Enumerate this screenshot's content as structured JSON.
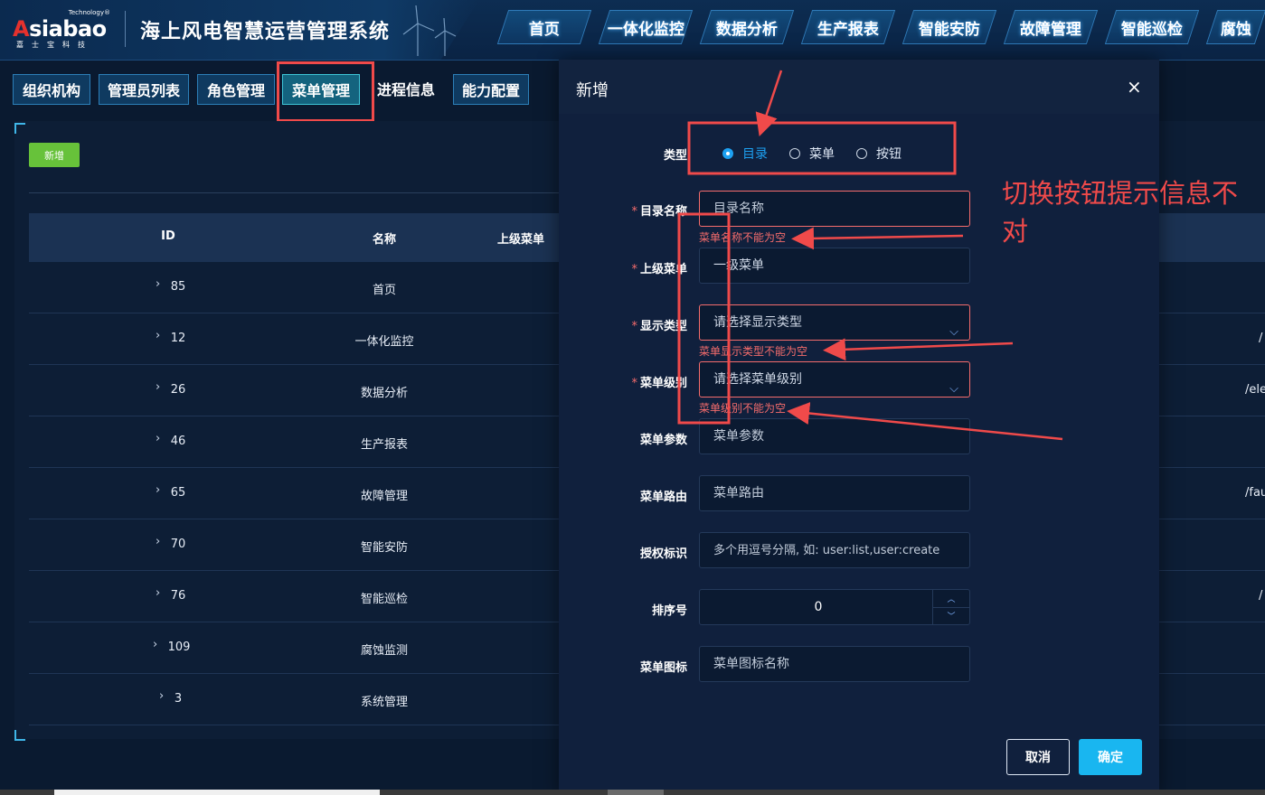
{
  "header": {
    "logo_tech": "Technology®",
    "logo_word_a": "A",
    "logo_word_rest": "siabao",
    "logo_cn": "嘉士宝科技",
    "title": "海上风电智慧运营管理系统",
    "nav": [
      "首页",
      "一体化监控",
      "数据分析",
      "生产报表",
      "智能安防",
      "故障管理",
      "智能巡检",
      "腐蚀"
    ]
  },
  "subtabs": [
    "组织机构",
    "管理员列表",
    "角色管理",
    "菜单管理",
    "进程信息",
    "能力配置"
  ],
  "active_subtab": "菜单管理",
  "toolbar": {
    "add_label": "新增"
  },
  "table": {
    "headers": {
      "id": "ID",
      "name": "名称",
      "parent": "上级菜单"
    },
    "rows": [
      {
        "id": "85",
        "name": "首页",
        "right": ""
      },
      {
        "id": "12",
        "name": "一体化监控",
        "right": "/"
      },
      {
        "id": "26",
        "name": "数据分析",
        "right": "/ele"
      },
      {
        "id": "46",
        "name": "生产报表",
        "right": ""
      },
      {
        "id": "65",
        "name": "故障管理",
        "right": "/fau"
      },
      {
        "id": "70",
        "name": "智能安防",
        "right": ""
      },
      {
        "id": "76",
        "name": "智能巡检",
        "right": "/"
      },
      {
        "id": "109",
        "name": "腐蚀监测",
        "right": ""
      },
      {
        "id": "3",
        "name": "系统管理",
        "right": ""
      }
    ]
  },
  "modal": {
    "title": "新增",
    "close": "×",
    "type_label": "类型",
    "type_options": [
      "目录",
      "菜单",
      "按钮"
    ],
    "type_selected": "目录",
    "fields": {
      "dir_name": {
        "label": "目录名称",
        "placeholder": "目录名称",
        "error": "菜单名称不能为空",
        "required": true
      },
      "parent": {
        "label": "上级菜单",
        "value": "一级菜单",
        "required": true
      },
      "display_type": {
        "label": "显示类型",
        "placeholder": "请选择显示类型",
        "error": "菜单显示类型不能为空",
        "required": true
      },
      "menu_level": {
        "label": "菜单级别",
        "placeholder": "请选择菜单级别",
        "error": "菜单级别不能为空",
        "required": true
      },
      "menu_param": {
        "label": "菜单参数",
        "placeholder": "菜单参数"
      },
      "menu_route": {
        "label": "菜单路由",
        "placeholder": "菜单路由"
      },
      "auth": {
        "label": "授权标识",
        "placeholder": "多个用逗号分隔, 如: user:list,user:create"
      },
      "sort": {
        "label": "排序号",
        "value": "0"
      },
      "icon": {
        "label": "菜单图标",
        "placeholder": "菜单图标名称"
      }
    },
    "cancel_label": "取消",
    "ok_label": "确定"
  },
  "annotation": {
    "text": "切换按钮提示信息不对",
    "color": "#f04a4a"
  },
  "colors": {
    "accent": "#19b6f0",
    "add_button": "#67c23a",
    "error": "#f56c6c",
    "annotation": "#f04a4a"
  }
}
